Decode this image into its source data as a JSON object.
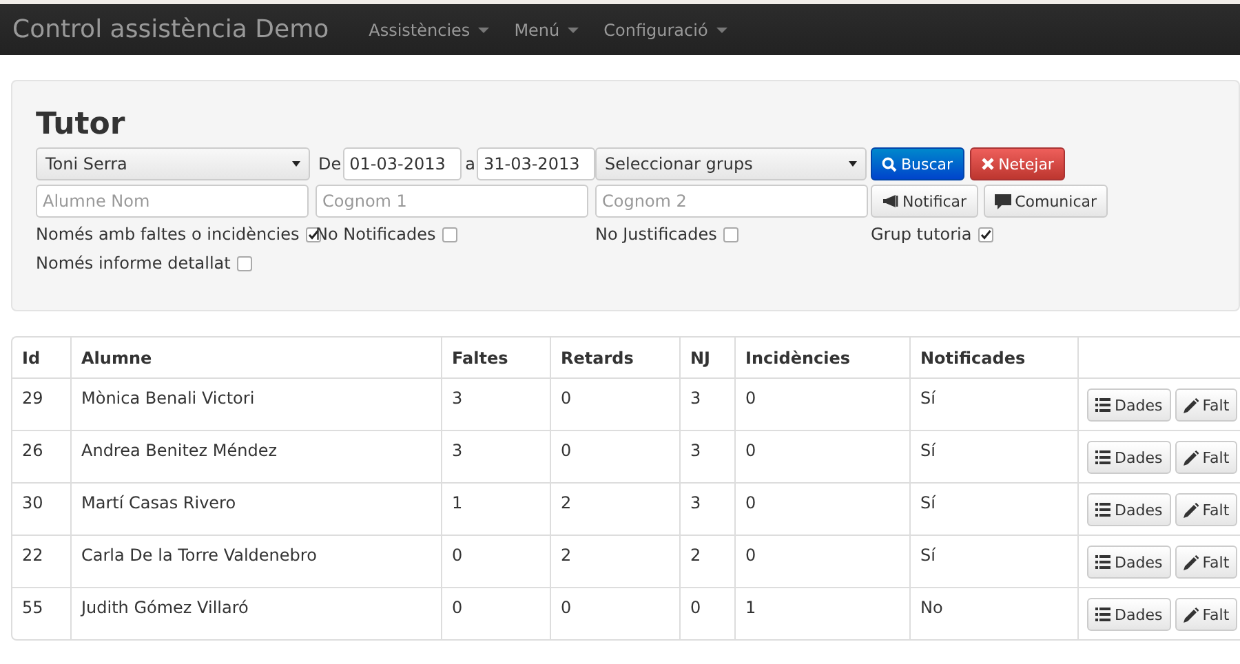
{
  "navbar": {
    "brand": "Control assistència Demo",
    "menus": [
      {
        "label": "Assistències"
      },
      {
        "label": "Menú"
      },
      {
        "label": "Configuració"
      }
    ]
  },
  "panel": {
    "title": "Tutor",
    "tutor_select": "Toni Serra",
    "from_label": "De",
    "from_date": "01-03-2013",
    "to_label": "a",
    "to_date": "31-03-2013",
    "groups_select": "Seleccionar grups",
    "buttons": [
      {
        "label": "Buscar",
        "kind": "search"
      },
      {
        "label": "Netejar",
        "kind": "clear"
      }
    ],
    "fields": [
      {
        "placeholder": "Alumne Nom"
      },
      {
        "placeholder": "Cognom 1"
      },
      {
        "placeholder": "Cognom 2"
      }
    ],
    "actions": [
      {
        "label": "Notificar",
        "kind": "notify"
      },
      {
        "label": "Comunicar",
        "kind": "comment"
      }
    ],
    "checks": [
      {
        "label": "Només amb faltes o incidències",
        "checked": true
      },
      {
        "label": "No Notificades",
        "checked": false
      },
      {
        "label": "No Justificades",
        "checked": false
      },
      {
        "label": "Grup tutoria",
        "checked": true
      },
      {
        "label": "Només informe detallat",
        "checked": false
      }
    ]
  },
  "table": {
    "columns": [
      "Id",
      "Alumne",
      "Faltes",
      "Retards",
      "NJ",
      "Incidències",
      "Notificades"
    ],
    "rows": [
      {
        "cells": [
          "29",
          "Mònica Benali Victori",
          "3",
          "0",
          "3",
          "0",
          "Sí"
        ],
        "actions": [
          {
            "label": "Dades",
            "kind": "list"
          },
          {
            "label": "Falt",
            "kind": "edit"
          }
        ]
      },
      {
        "cells": [
          "26",
          "Andrea Benitez Méndez",
          "3",
          "0",
          "3",
          "0",
          "Sí"
        ],
        "actions": [
          {
            "label": "Dades",
            "kind": "list"
          },
          {
            "label": "Falt",
            "kind": "edit"
          }
        ]
      },
      {
        "cells": [
          "30",
          "Martí Casas Rivero",
          "1",
          "2",
          "3",
          "0",
          "Sí"
        ],
        "actions": [
          {
            "label": "Dades",
            "kind": "list"
          },
          {
            "label": "Falt",
            "kind": "edit"
          }
        ]
      },
      {
        "cells": [
          "22",
          "Carla De la Torre Valdenebro",
          "0",
          "2",
          "2",
          "0",
          "Sí"
        ],
        "actions": [
          {
            "label": "Dades",
            "kind": "list"
          },
          {
            "label": "Falt",
            "kind": "edit"
          }
        ]
      },
      {
        "cells": [
          "55",
          "Judith Gómez Villaró",
          "0",
          "0",
          "0",
          "1",
          "No"
        ],
        "actions": [
          {
            "label": "Dades",
            "kind": "list"
          },
          {
            "label": "Falt",
            "kind": "edit"
          }
        ]
      }
    ]
  }
}
